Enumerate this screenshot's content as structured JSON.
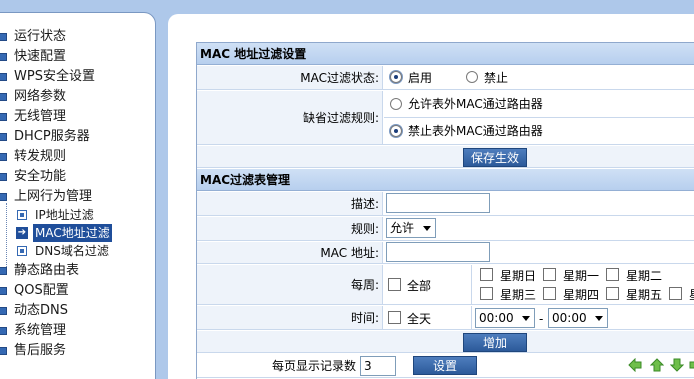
{
  "sidebar": {
    "items": [
      {
        "label": "运行状态"
      },
      {
        "label": "快速配置"
      },
      {
        "label": "WPS安全设置"
      },
      {
        "label": "网络参数"
      },
      {
        "label": "无线管理"
      },
      {
        "label": "DHCP服务器"
      },
      {
        "label": "转发规则"
      },
      {
        "label": "安全功能"
      },
      {
        "label": "上网行为管理"
      },
      {
        "label": "静态路由表"
      },
      {
        "label": "QOS配置"
      },
      {
        "label": "动态DNS"
      },
      {
        "label": "系统管理"
      },
      {
        "label": "售后服务"
      }
    ],
    "subitems": [
      {
        "label": "IP地址过滤"
      },
      {
        "label": "MAC地址过滤"
      },
      {
        "label": "DNS域名过滤"
      }
    ]
  },
  "mac_settings": {
    "title": "MAC 地址过滤设置",
    "status_label": "MAC过滤状态:",
    "status_on": "启用",
    "status_off": "禁止",
    "default_rule_label": "缺省过滤规则:",
    "rule_allow": "允许表外MAC通过路由器",
    "rule_deny": "禁止表外MAC通过路由器",
    "save_button": "保存生效"
  },
  "mac_table": {
    "title": "MAC过滤表管理",
    "desc_label": "描述:",
    "desc_value": "",
    "rule_label": "规则:",
    "rule_value": "允许",
    "mac_label": "MAC 地址:",
    "mac_value": "",
    "week_label": "每周:",
    "all_label": "全部",
    "days": [
      "星期日",
      "星期一",
      "星期二",
      "星期三",
      "星期四",
      "星期五",
      "星"
    ],
    "time_label": "时间:",
    "all_day_label": "全天",
    "time_start": "00:00",
    "time_sep": "-",
    "time_end": "00:00",
    "add_button": "增加"
  },
  "pager": {
    "per_page_label": "每页显示记录数",
    "per_page_value": "3",
    "set_button": "设置"
  }
}
